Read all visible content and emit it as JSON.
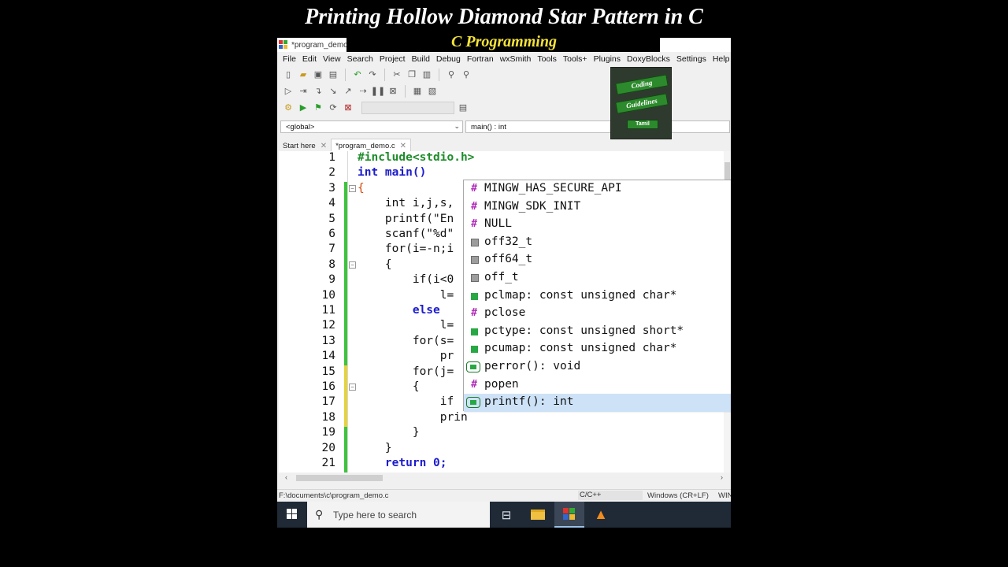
{
  "video": {
    "title": "Printing Hollow Diamond Star Pattern in C",
    "subtitle": "C Programming"
  },
  "window": {
    "title": "*program_demo"
  },
  "menu": [
    "File",
    "Edit",
    "View",
    "Search",
    "Project",
    "Build",
    "Debug",
    "Fortran",
    "wxSmith",
    "Tools",
    "Tools+",
    "Plugins",
    "DoxyBlocks",
    "Settings",
    "Help"
  ],
  "scope": {
    "global": "<global>",
    "function": "main() : int"
  },
  "tabs": [
    {
      "label": "Start here"
    },
    {
      "label": "*program_demo.c"
    }
  ],
  "editor": {
    "line_numbers": [
      "1",
      "2",
      "3",
      "4",
      "5",
      "6",
      "7",
      "8",
      "9",
      "10",
      "11",
      "12",
      "13",
      "14",
      "15",
      "16",
      "17",
      "18",
      "19",
      "20",
      "21"
    ],
    "lines": [
      "#include<stdio.h>",
      "int main()",
      "{",
      "    int i,j,s,",
      "    printf(\"En",
      "    scanf(\"%d\"",
      "    for(i=-n;i",
      "    {",
      "        if(i<0",
      "            l=",
      "        else",
      "            l=",
      "        for(s=",
      "            pr",
      "        for(j=",
      "        {",
      "            if",
      "            prin",
      "        }",
      "    }",
      "    return 0;"
    ]
  },
  "autocomplete": {
    "items": [
      {
        "kind": "macro",
        "label": "MINGW_HAS_SECURE_API"
      },
      {
        "kind": "macro",
        "label": "MINGW_SDK_INIT"
      },
      {
        "kind": "macro",
        "label": "NULL"
      },
      {
        "kind": "typedef",
        "label": "off32_t"
      },
      {
        "kind": "typedef",
        "label": "off64_t"
      },
      {
        "kind": "typedef",
        "label": "off_t"
      },
      {
        "kind": "variable",
        "label": "pclmap: const unsigned char*"
      },
      {
        "kind": "macro",
        "label": "pclose"
      },
      {
        "kind": "variable",
        "label": "pctype: const unsigned short*"
      },
      {
        "kind": "variable",
        "label": "pcumap: const unsigned char*"
      },
      {
        "kind": "function",
        "label": "perror(): void"
      },
      {
        "kind": "macro",
        "label": "popen"
      },
      {
        "kind": "function",
        "label": "printf(): int",
        "selected": true
      }
    ]
  },
  "statusbar": {
    "path": "F:\\documents\\c\\program_demo.c",
    "language": "C/C++",
    "line_endings": "Windows (CR+LF)",
    "encoding": "WIN"
  },
  "taskbar": {
    "search_placeholder": "Type here to search"
  },
  "logo": {
    "line1": "Coding",
    "line2": "Guidelines",
    "line3": "Tamil"
  },
  "colors": {
    "keyword": "#1c1ccc",
    "preprocessor": "#1e8c2a",
    "number": "#e0148c",
    "selection": "#cde2f7",
    "subtitle": "#f4e23a"
  }
}
